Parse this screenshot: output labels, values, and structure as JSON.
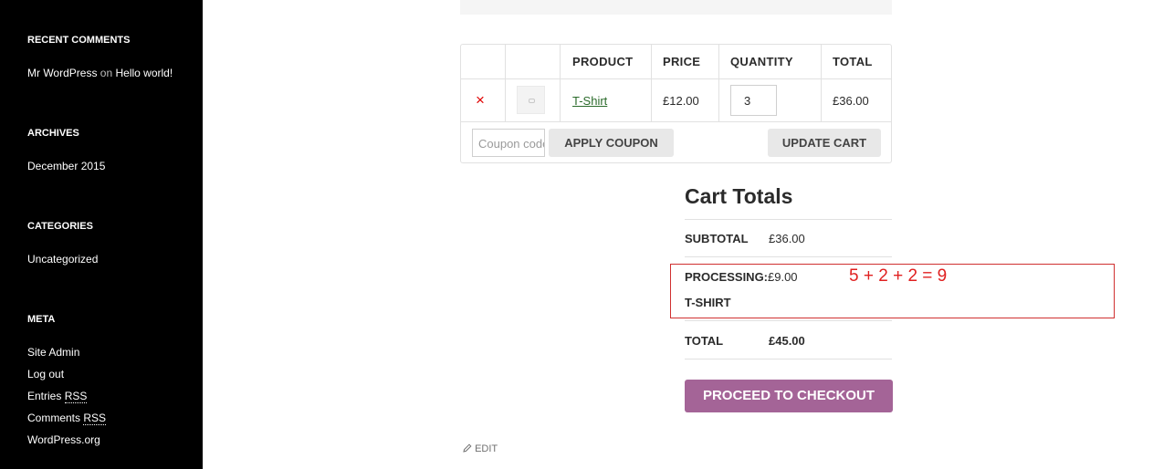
{
  "sidebar": {
    "recent_comments": {
      "title": "RECENT COMMENTS",
      "author": "Mr WordPress",
      "on": "on",
      "post": "Hello world!"
    },
    "archives": {
      "title": "ARCHIVES",
      "items": [
        "December 2015"
      ]
    },
    "categories": {
      "title": "CATEGORIES",
      "items": [
        "Uncategorized"
      ]
    },
    "meta": {
      "title": "META",
      "site_admin": "Site Admin",
      "log_out": "Log out",
      "entries": "Entries",
      "comments": "Comments",
      "rss": "RSS",
      "wordpress": "WordPress.org"
    }
  },
  "cart": {
    "headers": {
      "product": "PRODUCT",
      "price": "PRICE",
      "quantity": "QUANTITY",
      "total": "TOTAL"
    },
    "item": {
      "remove": "×",
      "name": "T-Shirt",
      "price": "£12.00",
      "quantity": "3",
      "total": "£36.00"
    },
    "coupon_placeholder": "Coupon code",
    "apply_coupon": "APPLY COUPON",
    "update_cart": "UPDATE CART"
  },
  "totals": {
    "title": "Cart Totals",
    "subtotal_label": "SUBTOTAL",
    "subtotal_value": "£36.00",
    "processing_label_1": "PROCESSING:",
    "processing_label_2": "T-SHIRT",
    "processing_value": "£9.00",
    "total_label": "TOTAL",
    "total_value": "£45.00",
    "checkout": "PROCEED TO CHECKOUT"
  },
  "annotation": {
    "text": "5 + 2 + 2 = 9",
    "color": "#e02020"
  },
  "edit": {
    "label": "EDIT",
    "icon": "pencil-icon"
  },
  "colors": {
    "sidebar_bg": "#000000",
    "checkout_bg": "#a46497",
    "link_green": "#2b6b2b",
    "remove_red": "#e00000"
  }
}
